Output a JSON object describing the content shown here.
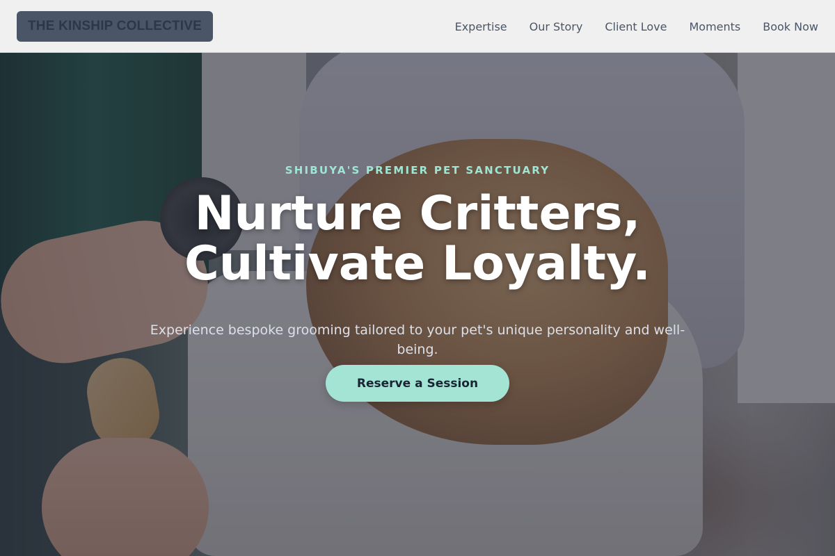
{
  "navbar": {
    "brand": "THE KINSHIP COLLECTIVE",
    "links": [
      "Expertise",
      "Our Story",
      "Client Love",
      "Moments",
      "Book Now"
    ]
  },
  "hero": {
    "eyebrow": "SHIBUYA'S PREMIER PET SANCTUARY",
    "headline_line1": "Nurture Critters,",
    "headline_line2": "Cultivate Loyalty.",
    "subline": "Experience bespoke grooming tailored to your pet's unique personality and well-being.",
    "cta_label": "Reserve a Session",
    "background_image": "dog-grooming-photo"
  },
  "colors": {
    "accent": "#a3e4d5",
    "eyebrow": "#9de6d3",
    "nav_bg": "#f0f0f0",
    "brand_bg": "#4a5568",
    "text_dark": "#2d3748"
  }
}
